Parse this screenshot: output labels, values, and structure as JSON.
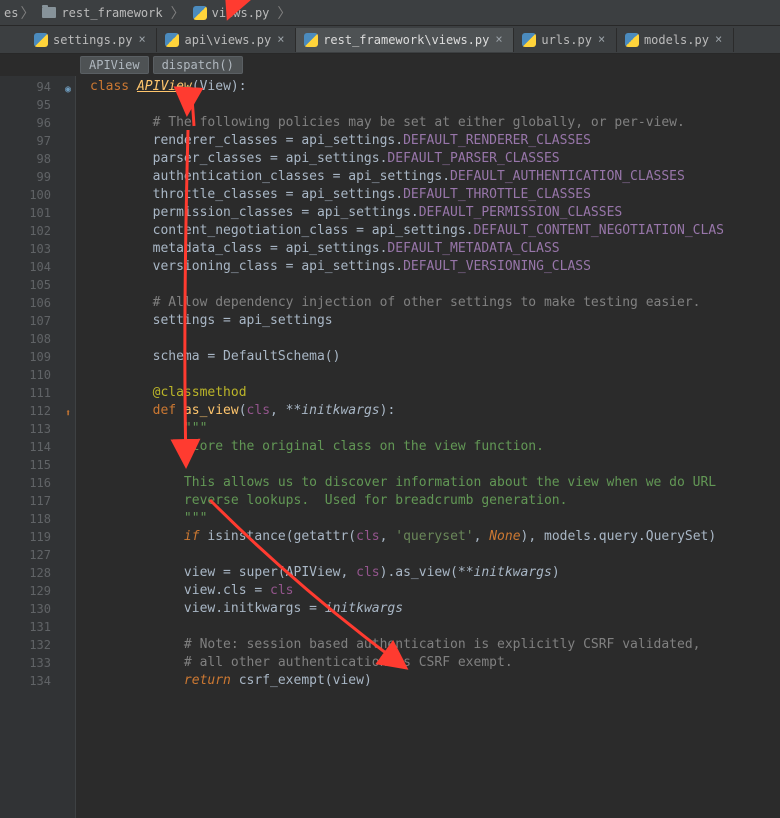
{
  "breadcrumb": {
    "truncated": "es",
    "folder": "rest_framework",
    "file": "views.py"
  },
  "tabs": [
    {
      "label": "settings.py",
      "active": false
    },
    {
      "label": "api\\views.py",
      "active": false
    },
    {
      "label": "rest_framework\\views.py",
      "active": true
    },
    {
      "label": "urls.py",
      "active": false
    },
    {
      "label": "models.py",
      "active": false
    }
  ],
  "inline_path": {
    "a": "APIView",
    "b": "dispatch()"
  },
  "gutter": [
    "94",
    "95",
    "96",
    "97",
    "98",
    "99",
    "100",
    "101",
    "102",
    "103",
    "104",
    "105",
    "106",
    "107",
    "108",
    "109",
    "110",
    "111",
    "112",
    "113",
    "114",
    "115",
    "116",
    "117",
    "118",
    "119",
    "127",
    "128",
    "129",
    "130",
    "131",
    "132",
    "133",
    "134"
  ],
  "code": {
    "l94_class": "class ",
    "l94_name": "APIView",
    "l94_paren": "(View):",
    "l96": "        # The following policies may be set at either globally, or per-view.",
    "l97a": "        renderer_classes = api_settings.",
    "l97b": "DEFAULT_RENDERER_CLASSES",
    "l98a": "        parser_classes = api_settings.",
    "l98b": "DEFAULT_PARSER_CLASSES",
    "l99a": "        authentication_classes = api_settings.",
    "l99b": "DEFAULT_AUTHENTICATION_CLASSES",
    "l100a": "        throttle_classes = api_settings.",
    "l100b": "DEFAULT_THROTTLE_CLASSES",
    "l101a": "        permission_classes = api_settings.",
    "l101b": "DEFAULT_PERMISSION_CLASSES",
    "l102a": "        content_negotiation_class = api_settings.",
    "l102b": "DEFAULT_CONTENT_NEGOTIATION_CLAS",
    "l103a": "        metadata_class = api_settings.",
    "l103b": "DEFAULT_METADATA_CLASS",
    "l104a": "        versioning_class = api_settings.",
    "l104b": "DEFAULT_VERSIONING_CLASS",
    "l106": "        # Allow dependency injection of other settings to make testing easier.",
    "l107": "        settings = api_settings",
    "l109": "        schema = DefaultSchema()",
    "l111": "        @classmethod",
    "l112_def": "        def ",
    "l112_name": "as_view",
    "l112_sig_a": "(",
    "l112_cls": "cls",
    "l112_sig_b": ", **",
    "l112_kw": "initkwargs",
    "l112_sig_c": "):",
    "l113": "            \"\"\"",
    "l114": "            Store the original class on the view function.",
    "l116": "            This allows us to discover information about the view when we do URL",
    "l117": "            reverse lookups.  Used for breadcrumb generation.",
    "l118": "            \"\"\"",
    "l119_if": "            if ",
    "l119_is": "isinstance",
    "l119_a": "(getattr(",
    "l119_cls": "cls",
    "l119_b": ", ",
    "l119_str": "'queryset'",
    "l119_c": ", ",
    "l119_none": "None",
    "l119_d": "), models.query.QuerySet)",
    "l128_a": "            view = ",
    "l128_super": "super",
    "l128_b": "(APIView, ",
    "l128_cls": "cls",
    "l128_c": ").as_view(**",
    "l128_kw": "initkwargs",
    "l128_d": ")",
    "l129_a": "            view.cls = ",
    "l129_cls": "cls",
    "l130_a": "            view.initkwargs = ",
    "l130_kw": "initkwargs",
    "l132": "            # Note: session based authentication is explicitly CSRF validated,",
    "l133": "            # all other authentication is CSRF exempt.",
    "l134_ret": "            return ",
    "l134_call": "csrf_exempt(view)"
  }
}
